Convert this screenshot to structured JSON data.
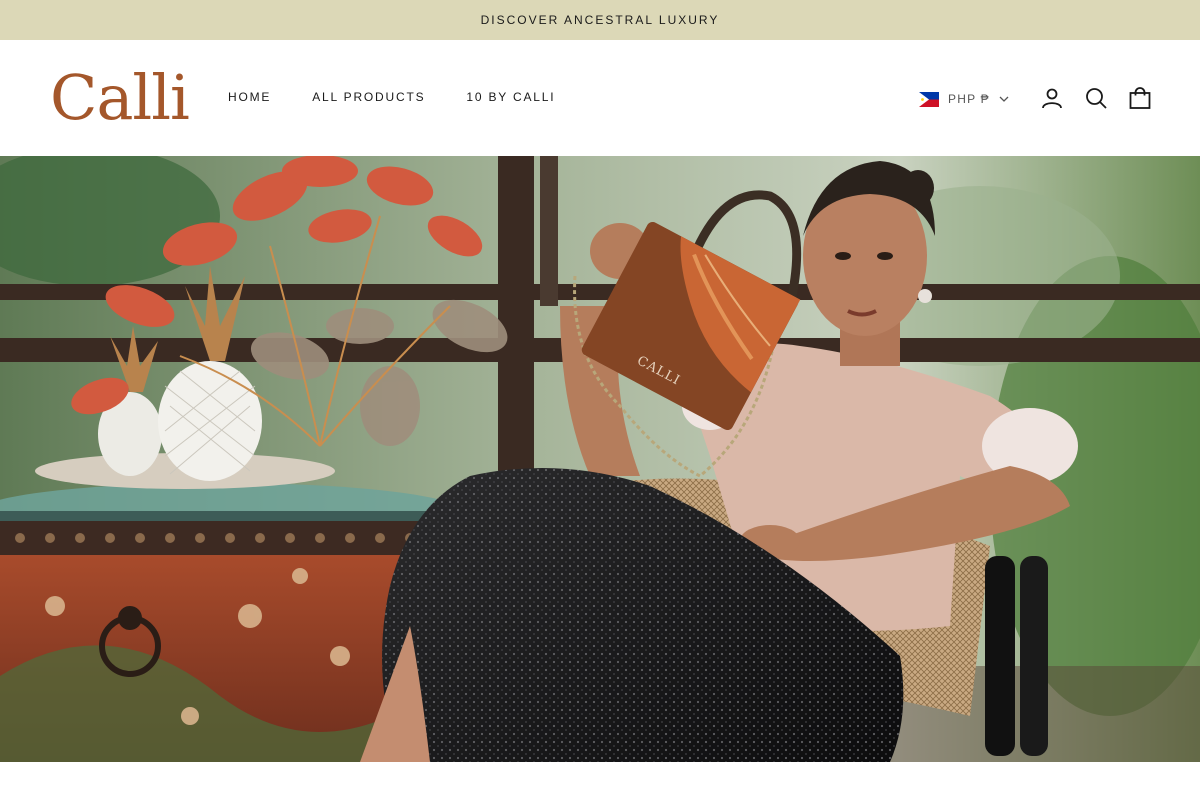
{
  "announcement": {
    "text": "DISCOVER ANCESTRAL LUXURY"
  },
  "header": {
    "logo": "Calli",
    "nav": [
      {
        "label": "HOME"
      },
      {
        "label": "ALL PRODUCTS"
      },
      {
        "label": "10 BY CALLI"
      }
    ],
    "currency": {
      "label": "PHP ₱",
      "flag": "philippines-flag-icon"
    },
    "icons": [
      "account-icon",
      "search-icon",
      "cart-icon"
    ]
  },
  "hero": {
    "bag_brand": "CALLI",
    "image": "model-holding-wooden-bag-photo"
  },
  "colors": {
    "announcement_bg": "#dcd8b7",
    "brand": "#a4572b"
  }
}
